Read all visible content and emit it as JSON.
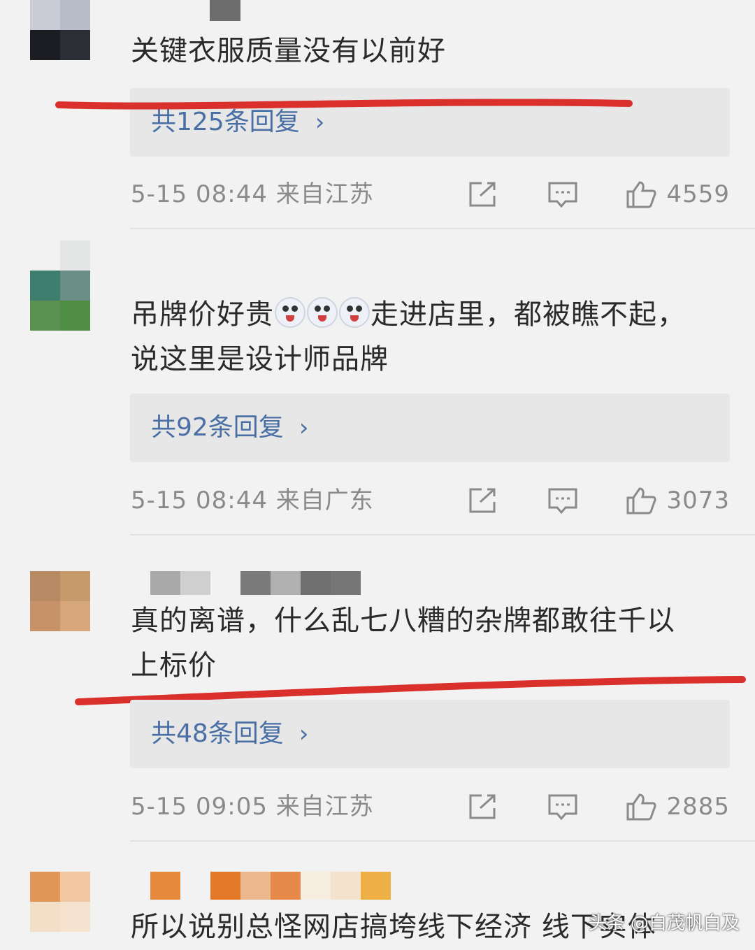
{
  "comments": [
    {
      "text": "关键衣服质量没有以前好",
      "reply": "共125条回复",
      "time": "5-15 08:44",
      "location": "来自江苏",
      "likes": "4559"
    },
    {
      "text_before_emoji": "吊牌价好贵",
      "text_after_emoji": "走进店里，都被瞧不起，",
      "line2": "说这里是设计师品牌",
      "reply": "共92条回复",
      "time": "5-15 08:44",
      "location": "来自广东",
      "likes": "3073"
    },
    {
      "line1": "真的离谱，什么乱七八糟的杂牌都敢往千以",
      "line2": "上标价",
      "reply": "共48条回复",
      "time": "5-15 09:05",
      "location": "来自江苏",
      "likes": "2885"
    },
    {
      "text": "所以说别总怪网店搞垮线下经济 线下实体"
    }
  ],
  "icons": {
    "share": "share-icon",
    "comment": "comment-icon",
    "like": "like-icon"
  },
  "chevron": "›",
  "watermark": "头条 @白茂帆白及",
  "colors": {
    "underline": "#d9302b",
    "reply_text": "#4a6fa5",
    "meta_text": "#8a8a8a"
  }
}
